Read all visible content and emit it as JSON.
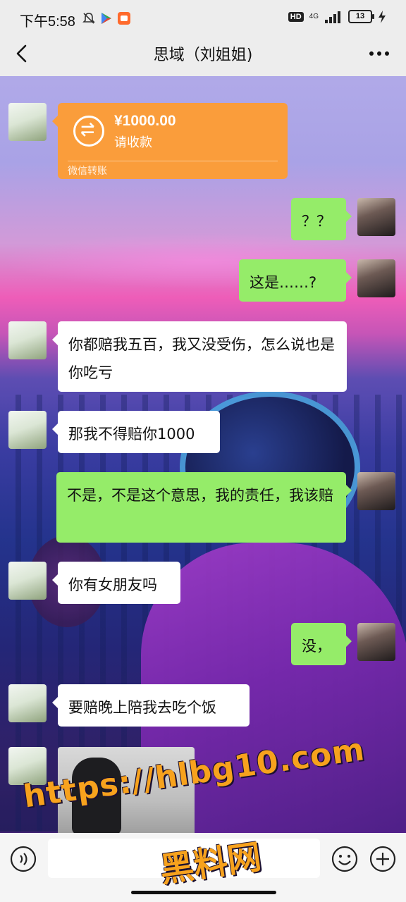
{
  "status_bar": {
    "time": "下午5:58",
    "hd_badge": "HD",
    "network": "4G",
    "battery": "13"
  },
  "header": {
    "title": "思域（刘姐姐)"
  },
  "transfer": {
    "amount": "¥1000.00",
    "status": "请收款",
    "footer": "微信转账",
    "accent_color": "#fa9d3b"
  },
  "messages": [
    {
      "side": "right",
      "text": "？？"
    },
    {
      "side": "right",
      "text": "这是……?"
    },
    {
      "side": "left",
      "text": "你都赔我五百，我又没受伤，怎么说也是你吃亏"
    },
    {
      "side": "left",
      "text": "那我不得赔你1000"
    },
    {
      "side": "right",
      "text": "不是，不是这个意思，我的责任，我该赔"
    },
    {
      "side": "left",
      "text": "你有女朋友吗"
    },
    {
      "side": "right",
      "text": "没，"
    },
    {
      "side": "left",
      "text": "要赔晚上陪我去吃个饭"
    }
  ],
  "watermark": {
    "url": "https://hlbg10.com",
    "name": "黑料网"
  },
  "colors": {
    "sent_bubble": "#95ec69",
    "received_bubble": "#ffffff",
    "header_bg": "#ededed"
  },
  "icons": {
    "back": "chevron-left-icon",
    "more": "more-dots-icon",
    "voice": "voice-icon",
    "emoji": "emoji-icon",
    "plus": "plus-icon"
  }
}
